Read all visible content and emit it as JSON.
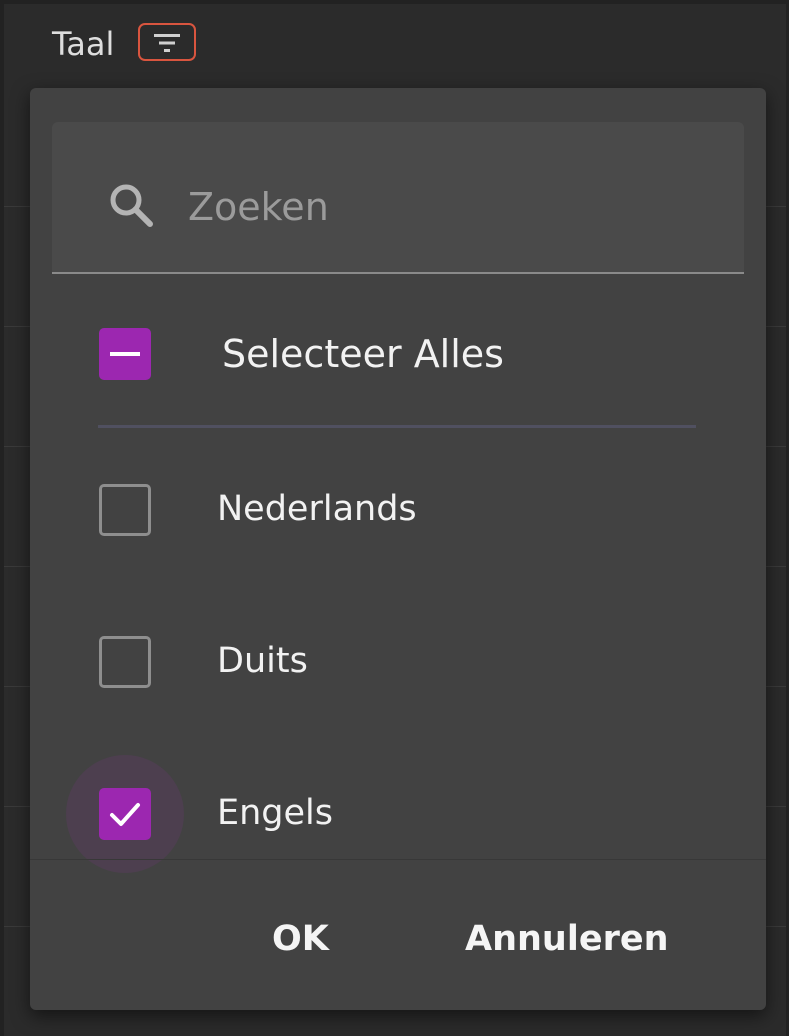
{
  "header": {
    "title": "Taal",
    "filter_icon": "filter-icon"
  },
  "search": {
    "placeholder": "Zoeken",
    "value": "",
    "icon": "search-icon"
  },
  "select_all": {
    "label": "Selecteer Alles",
    "state": "indeterminate"
  },
  "options": [
    {
      "label": "Nederlands",
      "checked": false
    },
    {
      "label": "Duits",
      "checked": false
    },
    {
      "label": "Engels",
      "checked": true
    }
  ],
  "buttons": {
    "ok": "OK",
    "cancel": "Annuleren"
  },
  "colors": {
    "accent": "#9c27b0",
    "highlight_border": "#d9553f",
    "popup_bg": "#424242"
  }
}
